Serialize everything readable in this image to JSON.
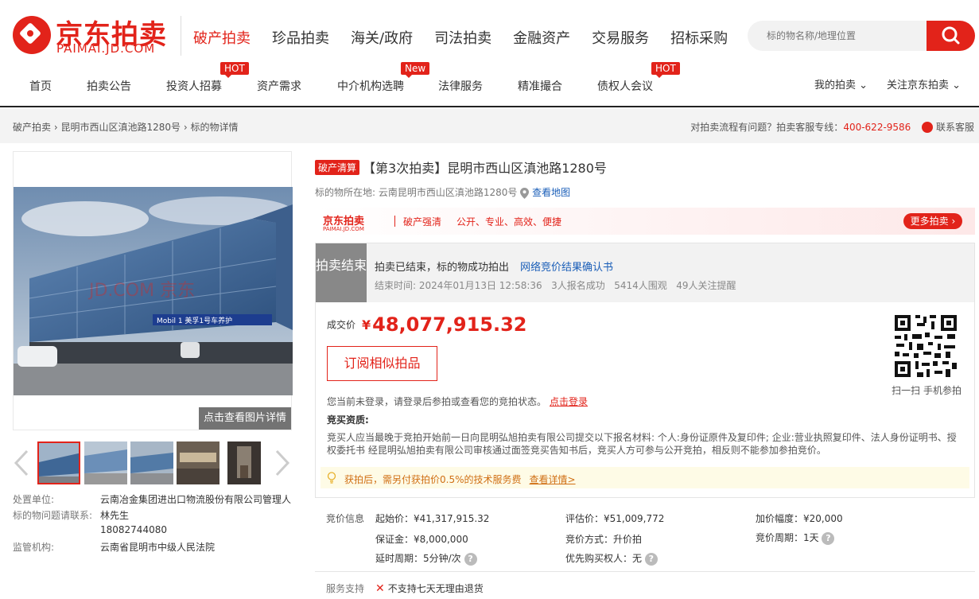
{
  "brand": {
    "name_cn": "京东拍卖",
    "name_en": "PAIMAI.JD.COM"
  },
  "main_nav": [
    "破产拍卖",
    "珍品拍卖",
    "海关/政府",
    "司法拍卖",
    "金融资产",
    "交易服务",
    "招标采购"
  ],
  "search": {
    "placeholder": "标的物名称/地理位置"
  },
  "sub_nav": [
    {
      "label": "首页",
      "badge": ""
    },
    {
      "label": "拍卖公告",
      "badge": ""
    },
    {
      "label": "投资人招募",
      "badge": "HOT"
    },
    {
      "label": "资产需求",
      "badge": ""
    },
    {
      "label": "中介机构选聘",
      "badge": "New"
    },
    {
      "label": "法律服务",
      "badge": ""
    },
    {
      "label": "精准撮合",
      "badge": ""
    },
    {
      "label": "债权人会议",
      "badge": "HOT"
    }
  ],
  "right_nav": {
    "my": "我的拍卖",
    "follow": "关注京东拍卖"
  },
  "breadcrumb": [
    "破产拍卖",
    "昆明市西山区滇池路1280号",
    "标的物详情"
  ],
  "support": {
    "question": "对拍卖流程有问题？拍卖客服专线：",
    "phone": "400-622-9586",
    "service": "联系客服"
  },
  "gallery": {
    "watermark": "JD.COM 京东",
    "sign": "Mobil 1 美孚1号车养护",
    "detail_btn": "点击查看图片详情"
  },
  "left_info": {
    "unit_label": "处置单位:",
    "unit": "云南冶金集团进出口物流股份有限公司管理人",
    "contact_label": "标的物问题请联系:",
    "contact_name": "林先生",
    "contact_phone": "18082744080",
    "court_label": "监管机构:",
    "court": "云南省昆明市中级人民法院"
  },
  "item": {
    "tag": "破产清算",
    "title": "【第3次拍卖】昆明市西山区滇池路1280号",
    "location_label": "标的物所在地:",
    "location": "云南昆明市西山区滇池路1280号",
    "map_link": "查看地图"
  },
  "banner": {
    "brand": "京东拍卖",
    "brand_en": "PAIMAI.JD.COM",
    "slogan1": "破产强清",
    "slogan2": "公开、专业、高效、便捷",
    "more": "更多拍卖"
  },
  "status": {
    "label": "拍卖结束",
    "message": "拍卖已结束，标的物成功拍出",
    "result_link": "网络竞价结果确认书",
    "end_time_label": "结束时间:",
    "end_time": "2024年01月13日 12:58:36",
    "registered": "3人报名成功",
    "viewers": "5414人围观",
    "reminders": "49人关注提醒"
  },
  "deal": {
    "label": "成交价",
    "currency": "¥",
    "price": "48,077,915.32"
  },
  "subscribe_btn": "订阅相似拍品",
  "qr_text": "扫一扫 手机参拍",
  "login_notice": {
    "text": "您当前未登录，请登录后参拍或查看您的竞拍状态。",
    "link": "点击登录"
  },
  "qualification": {
    "heading": "竞买资质:",
    "text": "竞买人应当最晚于竞拍开始前一日向昆明弘旭拍卖有限公司提交以下报名材料: 个人:身份证原件及复印件; 企业:营业执照复印件、法人身份证明书、授权委托书 经昆明弘旭拍卖有限公司审核通过面签竞买告知书后，竞买人方可参与公开竞拍，相反则不能参加参拍竞价。"
  },
  "fee_tip": {
    "text": "获拍后，需另付获拍价0.5%的技术服务费",
    "link": "查看详情>"
  },
  "bid_info": {
    "section": "竞价信息",
    "start_price": "起始价：¥41,317,915.32",
    "eval_price": "评估价：¥51,009,772",
    "increment": "加价幅度：¥20,000",
    "deposit": "保证金：¥8,000,000",
    "method": "竞价方式：升价拍",
    "cycle": "竞价周期：1天",
    "delay": "延时周期：5分钟/次",
    "priority": "优先购买权人：无"
  },
  "service": {
    "label": "服务支持",
    "text": "不支持七天无理由退货"
  },
  "colors": {
    "brand_red": "#e2231a",
    "link_blue": "#1a5eb8",
    "tip_orange": "#d06f14"
  }
}
